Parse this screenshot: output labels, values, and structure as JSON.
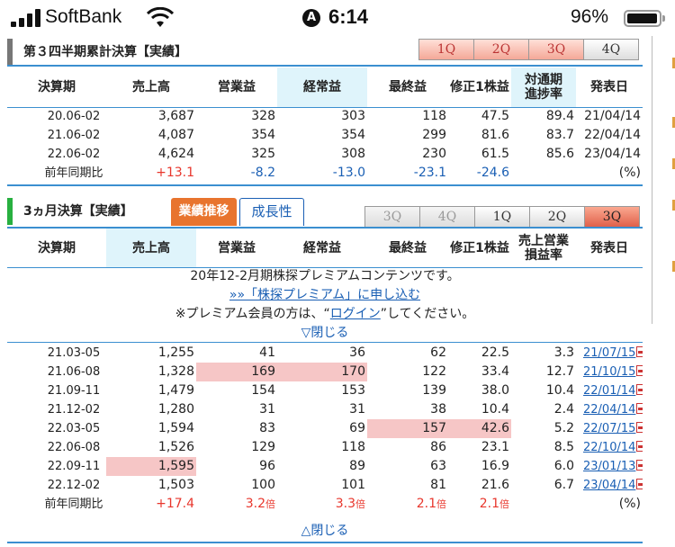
{
  "status_bar": {
    "carrier": "SoftBank",
    "time": "6:14",
    "location_glyph": "A",
    "battery": "96%"
  },
  "section1": {
    "title": "第３四半期累計決算【実績】",
    "quarter_tabs": [
      "1Q",
      "2Q",
      "3Q",
      "4Q"
    ],
    "headers": [
      "決算期",
      "売上高",
      "営業益",
      "経常益",
      "最終益",
      "修正1株益",
      "対通期\n進捗率",
      "発表日"
    ],
    "rows": [
      [
        "20.06-02",
        "3,687",
        "328",
        "303",
        "118",
        "47.5",
        "89.4",
        "21/04/14"
      ],
      [
        "21.06-02",
        "4,087",
        "354",
        "354",
        "299",
        "81.6",
        "83.7",
        "22/04/14"
      ],
      [
        "22.06-02",
        "4,624",
        "325",
        "308",
        "230",
        "61.5",
        "85.6",
        "23/04/14"
      ]
    ],
    "yoy": [
      "前年同期比",
      "+13.1",
      "-8.2",
      "-13.0",
      "-23.1",
      "-24.6",
      "",
      "(%)"
    ]
  },
  "section2": {
    "title": "3ヵ月決算【実績】",
    "btn_results": "業績推移",
    "btn_growth": "成長性",
    "quarter_tabs": [
      "3Q",
      "4Q",
      "1Q",
      "2Q",
      "3Q"
    ],
    "headers": [
      "決算期",
      "売上高",
      "営業益",
      "経常益",
      "最終益",
      "修正1株益",
      "売上営業\n損益率",
      "発表日"
    ],
    "premium_line1": "20年12-2月期株探プレミアムコンテンツです。",
    "premium_line2": "»»「株探プレミアム」に申し込む",
    "premium_line3_pre": "※プレミアム会員の方は、“",
    "premium_login": "ログイン",
    "premium_line3_post": "”してください。",
    "premium_close": "▽閉じる",
    "rows": [
      [
        "21.03-05",
        "1,255",
        "41",
        "36",
        "62",
        "22.5",
        "3.3",
        "21/07/15"
      ],
      [
        "21.06-08",
        "1,328",
        "169",
        "170",
        "122",
        "33.4",
        "12.7",
        "21/10/15"
      ],
      [
        "21.09-11",
        "1,479",
        "154",
        "153",
        "139",
        "38.0",
        "10.4",
        "22/01/14"
      ],
      [
        "21.12-02",
        "1,280",
        "31",
        "31",
        "38",
        "10.4",
        "2.4",
        "22/04/14"
      ],
      [
        "22.03-05",
        "1,594",
        "83",
        "69",
        "157",
        "42.6",
        "5.2",
        "22/07/15"
      ],
      [
        "22.06-08",
        "1,526",
        "129",
        "118",
        "86",
        "23.1",
        "8.5",
        "22/10/14"
      ],
      [
        "22.09-11",
        "1,595",
        "96",
        "89",
        "63",
        "16.9",
        "6.0",
        "23/01/13"
      ],
      [
        "22.12-02",
        "1,503",
        "100",
        "101",
        "81",
        "21.6",
        "6.7",
        "23/04/14"
      ]
    ],
    "yoy": [
      "前年同期比",
      "+17.4",
      "3.2",
      "3.3",
      "2.1",
      "2.1",
      "",
      "(%)"
    ],
    "yoy_unit": "倍",
    "bottom_close": "△閉じる"
  },
  "colors": {
    "accent_blue": "#3b8fd0",
    "header_highlight": "#dff4fb",
    "cell_highlight": "#f6c6c6",
    "positive_red": "#e8362c",
    "negative_blue": "#1a5fb4",
    "orange_button": "#e8742e"
  }
}
